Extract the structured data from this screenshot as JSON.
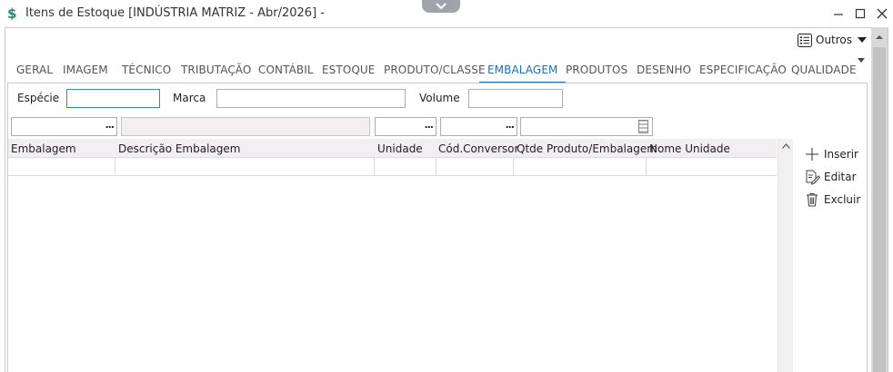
{
  "window": {
    "title": "Itens de Estoque [INDÚSTRIA MATRIZ - Abr/2026]  -",
    "accent": "#1e6fb8",
    "app_icon": "$"
  },
  "toolbar": {
    "outros_label": "Outros"
  },
  "tabs": [
    {
      "label": "GERAL",
      "active": false
    },
    {
      "label": "IMAGEM",
      "active": false
    },
    {
      "label": "TÉCNICO",
      "active": false
    },
    {
      "label": "TRIBUTAÇÃO",
      "active": false
    },
    {
      "label": "CONTÁBIL",
      "active": false
    },
    {
      "label": "ESTOQUE",
      "active": false
    },
    {
      "label": "PRODUTO/CLASSE",
      "active": false
    },
    {
      "label": "EMBALAGEM",
      "active": true
    },
    {
      "label": "PRODUTOS",
      "active": false
    },
    {
      "label": "DESENHO",
      "active": false
    },
    {
      "label": "ESPECIFICAÇÃO",
      "active": false
    },
    {
      "label": "QUALIDADE",
      "active": false
    }
  ],
  "form": {
    "especie_label": "Espécie",
    "especie_value": "",
    "marca_label": "Marca",
    "marca_value": "",
    "volume_label": "Volume",
    "volume_value": "",
    "lookup_button": "..."
  },
  "grid": {
    "columns": [
      "Embalagem",
      "Descrição Embalagem",
      "Unidade",
      "Cód.Conversor",
      "Qtde Produto/Embalagem",
      "Nome Unidade"
    ],
    "rows": []
  },
  "actions": {
    "insert_label": "Inserir",
    "edit_label": "Editar",
    "delete_label": "Excluir"
  }
}
